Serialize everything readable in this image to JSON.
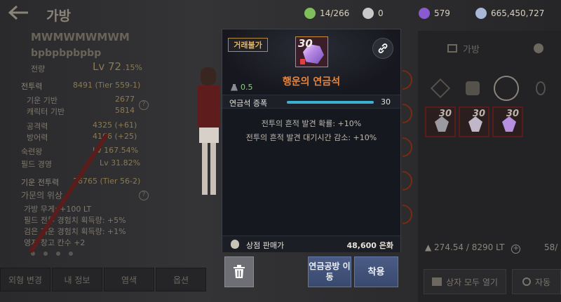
{
  "header": {
    "title": "가방",
    "currencies": [
      {
        "icon": "energy-icon",
        "value": "14/266",
        "color": "#7fbf5a"
      },
      {
        "icon": "coin-icon",
        "value": "0",
        "color": "#c9c9c9"
      },
      {
        "icon": "pearl-icon",
        "value": "579",
        "color": "#8a5ad0"
      },
      {
        "icon": "silver-icon",
        "value": "665,450,727",
        "color": "#a8b8d8"
      }
    ]
  },
  "character": {
    "name": "MWMWMWMWM",
    "family": "bpbpbpbpbp",
    "level_label": "전량",
    "level": "Lv 72",
    "level_pct": ".15%",
    "combat_power_label": "전투력",
    "combat_power": "8491 (Tier 559-1)",
    "base_label": "기운 기반",
    "base_value": "2677",
    "char_base_label": "캐릭터 기반",
    "char_base_value": "5814",
    "attack_label": "공격력",
    "attack_value": "4325 (+61)",
    "defense_label": "방어력",
    "defense_value": "4166 (+25)",
    "proficiency_label": "숙련왕",
    "proficiency_value": "Lv 167.54%",
    "field_label": "필드 경영",
    "field_value": "Lv 31.82%",
    "family_power_label": "기운 전투력",
    "family_power_value": "26765 (Tier 56-2)",
    "family_prestige": "가문의 위상",
    "bonuses": [
      "가방 무게: +100 LT",
      "필드 전투 경험치 획득량: +5%",
      "검은 기운 경험치 획득량: +1%",
      "영지 창고 칸수 +2"
    ],
    "bottom_tabs": [
      "외형 변경",
      "내 정보",
      "염색",
      "옵션"
    ]
  },
  "inventory": {
    "tabs": [
      "가방",
      ""
    ],
    "slots": [
      {
        "count": "30",
        "gem_color": "#9a9aa0"
      },
      {
        "count": "30",
        "gem_color": "#c0b8c8"
      },
      {
        "count": "30",
        "gem_color": "#b890e0"
      }
    ],
    "weight": "274.54 / 8290 LT",
    "page": "58/",
    "open_all": "상자 모두 열기",
    "auto": "자동"
  },
  "popup": {
    "trade_badge": "거래불가",
    "item_count": "30",
    "item_name": "행운의 연금석",
    "weight": "0.5",
    "stat_label": "연금석 증폭",
    "stat_value": "30",
    "stat_fill": 1.0,
    "effects": [
      "전투의 흔적 발견 확률: +10%",
      "전투의 흔적 발견 대기시간 감소: +10%"
    ],
    "sell_label": "상점 판매가",
    "sell_value": "48,600 은화",
    "buttons": {
      "move": "연금공방 이동",
      "equip": "착용"
    }
  }
}
